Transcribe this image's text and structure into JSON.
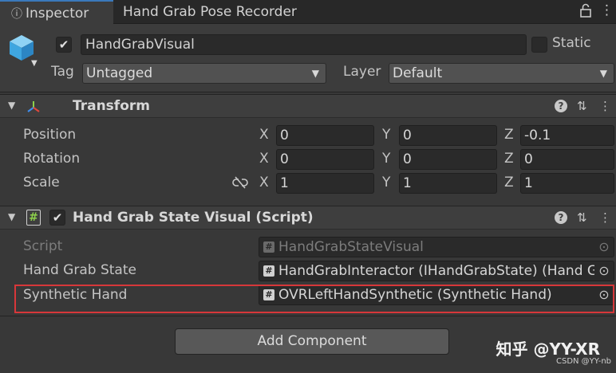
{
  "tabs": [
    {
      "label": "Inspector"
    },
    {
      "label": "Hand Grab Pose Recorder"
    }
  ],
  "window_icons": {
    "lock": "lock-icon",
    "menu": "kebab-menu-icon"
  },
  "gameobject": {
    "active": true,
    "name": "HandGrabVisual",
    "static_label": "Static",
    "tag_label": "Tag",
    "tag_value": "Untagged",
    "layer_label": "Layer",
    "layer_value": "Default"
  },
  "transform": {
    "title": "Transform",
    "rows": [
      {
        "label": "Position",
        "x": "0",
        "y": "0",
        "z": "-0.1"
      },
      {
        "label": "Rotation",
        "x": "0",
        "y": "0",
        "z": "0"
      },
      {
        "label": "Scale",
        "x": "1",
        "y": "1",
        "z": "1"
      }
    ],
    "axes": [
      "X",
      "Y",
      "Z"
    ]
  },
  "script_component": {
    "enabled": true,
    "title": "Hand Grab State Visual (Script)",
    "fields": [
      {
        "label": "Script",
        "value": "HandGrabStateVisual",
        "disabled": true
      },
      {
        "label": "Hand Grab State",
        "value": "HandGrabInteractor (IHandGrabState) (Hand G",
        "disabled": false
      },
      {
        "label": "Synthetic Hand",
        "value": "OVRLeftHandSynthetic (Synthetic Hand)",
        "disabled": false
      }
    ]
  },
  "add_component_label": "Add Component",
  "watermark": "知乎 @YY-XR",
  "credit": "CSDN @YY-nb",
  "colors": {
    "accent": "#3a79bb",
    "highlight": "#d7373a",
    "background": "#383838"
  }
}
